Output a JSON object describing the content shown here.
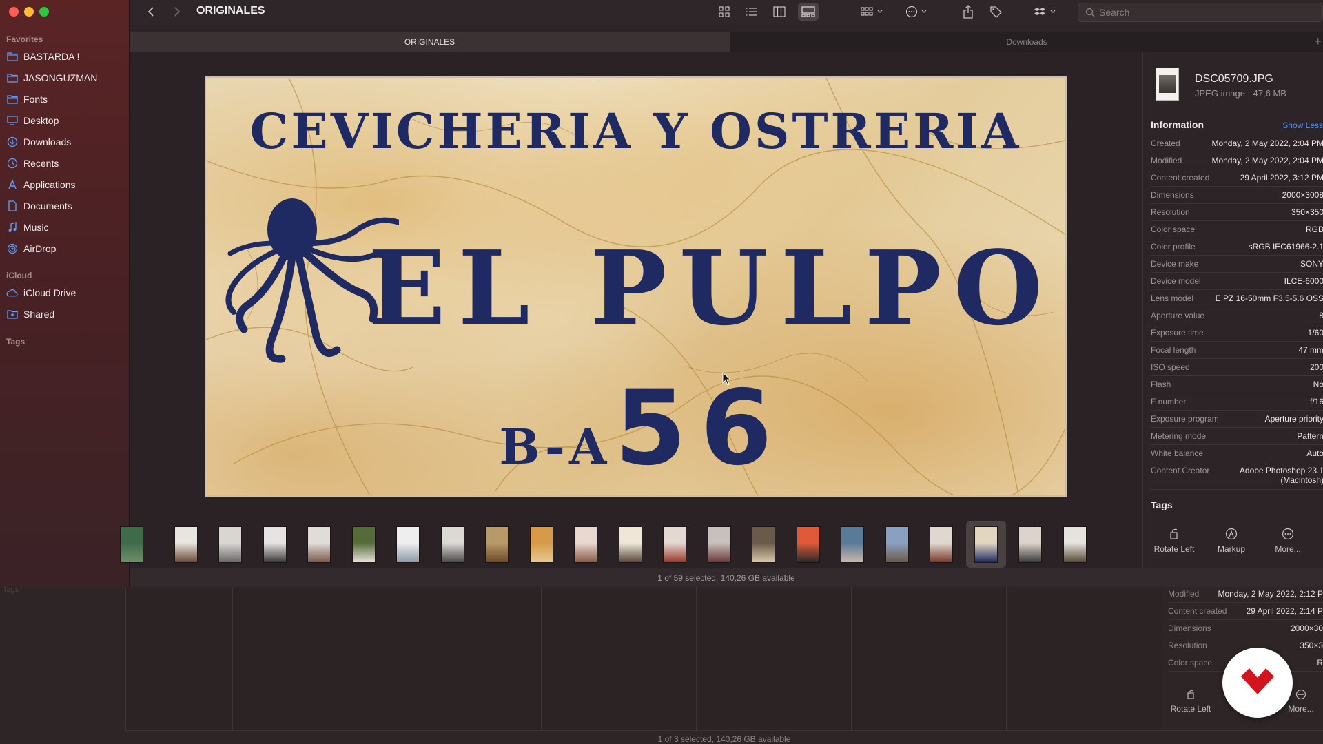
{
  "window": {
    "title": "ORIGINALES"
  },
  "sidebar": {
    "favorites_label": "Favorites",
    "favorites": [
      {
        "label": "BASTARDA !",
        "icon": "folder-icon"
      },
      {
        "label": "JASONGUZMAN",
        "icon": "folder-icon"
      },
      {
        "label": "Fonts",
        "icon": "folder-icon"
      },
      {
        "label": "Desktop",
        "icon": "desktop-icon"
      },
      {
        "label": "Downloads",
        "icon": "downloads-icon"
      },
      {
        "label": "Recents",
        "icon": "clock-icon"
      },
      {
        "label": "Applications",
        "icon": "applications-icon"
      },
      {
        "label": "Documents",
        "icon": "document-icon"
      },
      {
        "label": "Music",
        "icon": "music-icon"
      },
      {
        "label": "AirDrop",
        "icon": "airdrop-icon"
      }
    ],
    "icloud_label": "iCloud",
    "icloud": [
      {
        "label": "iCloud Drive",
        "icon": "cloud-icon"
      },
      {
        "label": "Shared",
        "icon": "shared-folder-icon"
      }
    ],
    "tags_label": "Tags"
  },
  "toolbar": {
    "search_placeholder": "Search"
  },
  "tabs": [
    {
      "label": "ORIGINALES",
      "active": true
    },
    {
      "label": "Downloads",
      "active": false
    }
  ],
  "preview": {
    "line1": "CEVICHERIA Y OSTRERIA",
    "line2": "EL PULPO",
    "line3_small": "B-A",
    "line3_big": "56"
  },
  "filmstrip": {
    "count": 22,
    "selected_index": 19
  },
  "status": {
    "text": "1 of 59 selected, 140,26 GB available"
  },
  "inspector": {
    "file_name": "DSC05709.JPG",
    "file_kind": "JPEG image - 47,6 MB",
    "info_title": "Information",
    "show_less": "Show Less",
    "rows": [
      {
        "k": "Created",
        "v": "Monday, 2 May 2022, 2:04 PM"
      },
      {
        "k": "Modified",
        "v": "Monday, 2 May 2022, 2:04 PM"
      },
      {
        "k": "Content created",
        "v": "29 April 2022, 3:12 PM"
      },
      {
        "k": "Dimensions",
        "v": "2000×3008"
      },
      {
        "k": "Resolution",
        "v": "350×350"
      },
      {
        "k": "Color space",
        "v": "RGB"
      },
      {
        "k": "Color profile",
        "v": "sRGB IEC61966-2.1"
      },
      {
        "k": "Device make",
        "v": "SONY"
      },
      {
        "k": "Device model",
        "v": "ILCE-6000"
      },
      {
        "k": "Lens model",
        "v": "E PZ 16-50mm F3.5-5.6 OSS"
      },
      {
        "k": "Aperture value",
        "v": "8"
      },
      {
        "k": "Exposure time",
        "v": "1/60"
      },
      {
        "k": "Focal length",
        "v": "47 mm"
      },
      {
        "k": "ISO speed",
        "v": "200"
      },
      {
        "k": "Flash",
        "v": "No"
      },
      {
        "k": "F number",
        "v": "f/16"
      },
      {
        "k": "Exposure program",
        "v": "Aperture priority"
      },
      {
        "k": "Metering mode",
        "v": "Pattern"
      },
      {
        "k": "White balance",
        "v": "Auto"
      },
      {
        "k": "Content Creator",
        "v": "Adobe Photoshop 23.1 (Macintosh)"
      }
    ],
    "tags_title": "Tags",
    "actions": [
      {
        "label": "Rotate Left",
        "icon": "rotate-left-icon"
      },
      {
        "label": "Markup",
        "icon": "markup-icon"
      },
      {
        "label": "More...",
        "icon": "more-icon"
      }
    ]
  },
  "background_window": {
    "tags_label": "Tags",
    "rows": [
      {
        "k": "Modified",
        "v": "Monday, 2 May 2022, 2:12 P"
      },
      {
        "k": "Content created",
        "v": "29 April 2022, 2:14 P"
      },
      {
        "k": "Dimensions",
        "v": "2000×30"
      },
      {
        "k": "Resolution",
        "v": "350×3"
      },
      {
        "k": "Color space",
        "v": "R"
      }
    ],
    "actions": [
      {
        "label": "Rotate Left"
      },
      {
        "label": "More..."
      }
    ],
    "status": "1 of 3 selected, 140,26 GB available"
  },
  "colors": {
    "sidebar_top": "#5a2425",
    "sign_ink": "#1f2a63",
    "accent_link": "#4d8fff",
    "brand_red": "#d2141e"
  }
}
